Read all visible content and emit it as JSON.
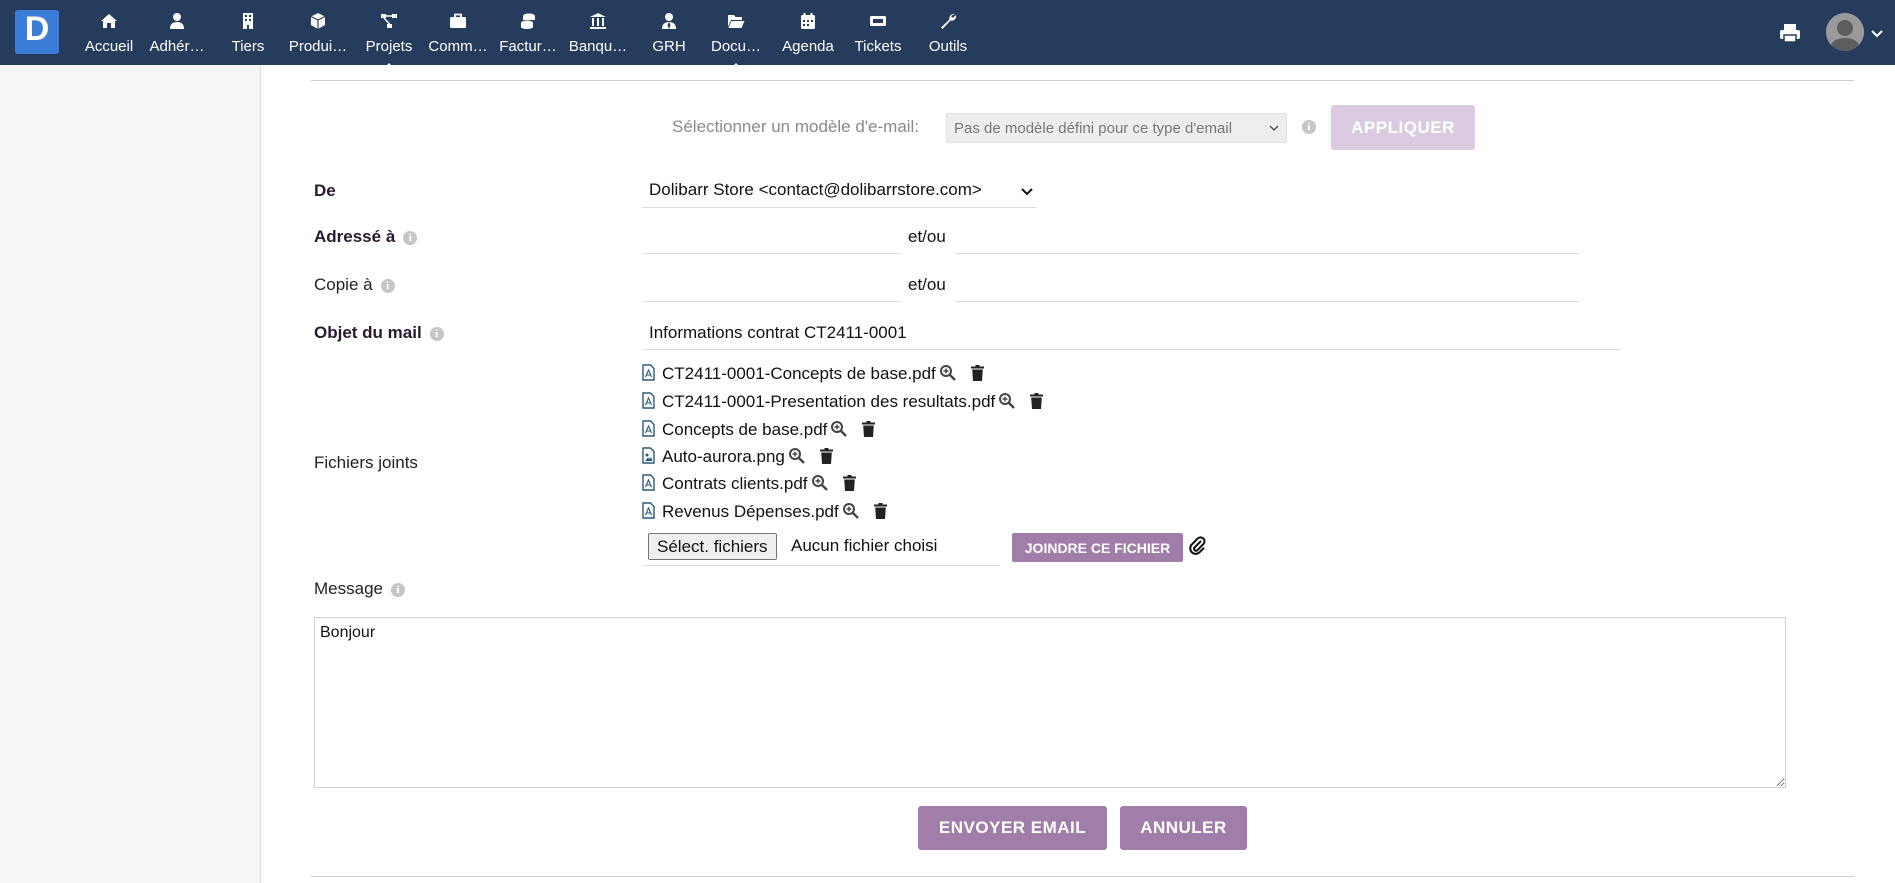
{
  "header": {
    "logo_letter": "D",
    "nav": [
      {
        "label": "Accueil",
        "icon": "home-icon"
      },
      {
        "label": "Adhér…",
        "icon": "user-icon"
      },
      {
        "label": "Tiers",
        "icon": "building-icon"
      },
      {
        "label": "Produi…",
        "icon": "cube-icon"
      },
      {
        "label": "Projets",
        "icon": "sitemap-icon"
      },
      {
        "label": "Comm…",
        "icon": "briefcase-icon"
      },
      {
        "label": "Factur…",
        "icon": "coins-icon"
      },
      {
        "label": "Banqu…",
        "icon": "bank-icon"
      },
      {
        "label": "GRH",
        "icon": "user-tie-icon"
      },
      {
        "label": "Docu…",
        "icon": "folder-open-icon"
      },
      {
        "label": "Agenda",
        "icon": "calendar-icon"
      },
      {
        "label": "Tickets",
        "icon": "ticket-icon"
      },
      {
        "label": "Outils",
        "icon": "wrench-icon"
      }
    ]
  },
  "form": {
    "template_label": "Sélectionner un modèle d'e-mail:",
    "template_value": "Pas de modèle défini pour ce type d'email",
    "apply_label": "APPLIQUER",
    "from_label": "De",
    "from_value": "Dolibarr Store <contact@dolibarrstore.com>",
    "to_label": "Adressé à",
    "cc_label": "Copie à",
    "and_or": "et/ou",
    "to_value": "",
    "to_extra_value": "",
    "cc_value": "",
    "cc_extra_value": "",
    "subject_label": "Objet du mail",
    "subject_value": "Informations contrat CT2411-0001",
    "attachments_label": "Fichiers joints",
    "attachments": [
      {
        "name": "CT2411-0001-Concepts de base.pdf",
        "type": "pdf"
      },
      {
        "name": "CT2411-0001-Presentation des resultats.pdf",
        "type": "pdf"
      },
      {
        "name": "Concepts de base.pdf",
        "type": "pdf"
      },
      {
        "name": "Auto-aurora.png",
        "type": "image"
      },
      {
        "name": "Contrats clients.pdf",
        "type": "pdf"
      },
      {
        "name": "Revenus Dépenses.pdf",
        "type": "pdf"
      }
    ],
    "file_button": "Sélect. fichiers",
    "file_none": "Aucun fichier choisi",
    "join_label": "JOINDRE CE FICHIER",
    "message_label": "Message",
    "message_value": "Bonjour",
    "send_label": "ENVOYER EMAIL",
    "cancel_label": "ANNULER"
  },
  "colors": {
    "topbar": "#263c5c",
    "logo": "#3b7dd8",
    "accent": "#a17ea9",
    "accent_disabled": "#dacbe0",
    "label_dark": "#2a1930"
  }
}
